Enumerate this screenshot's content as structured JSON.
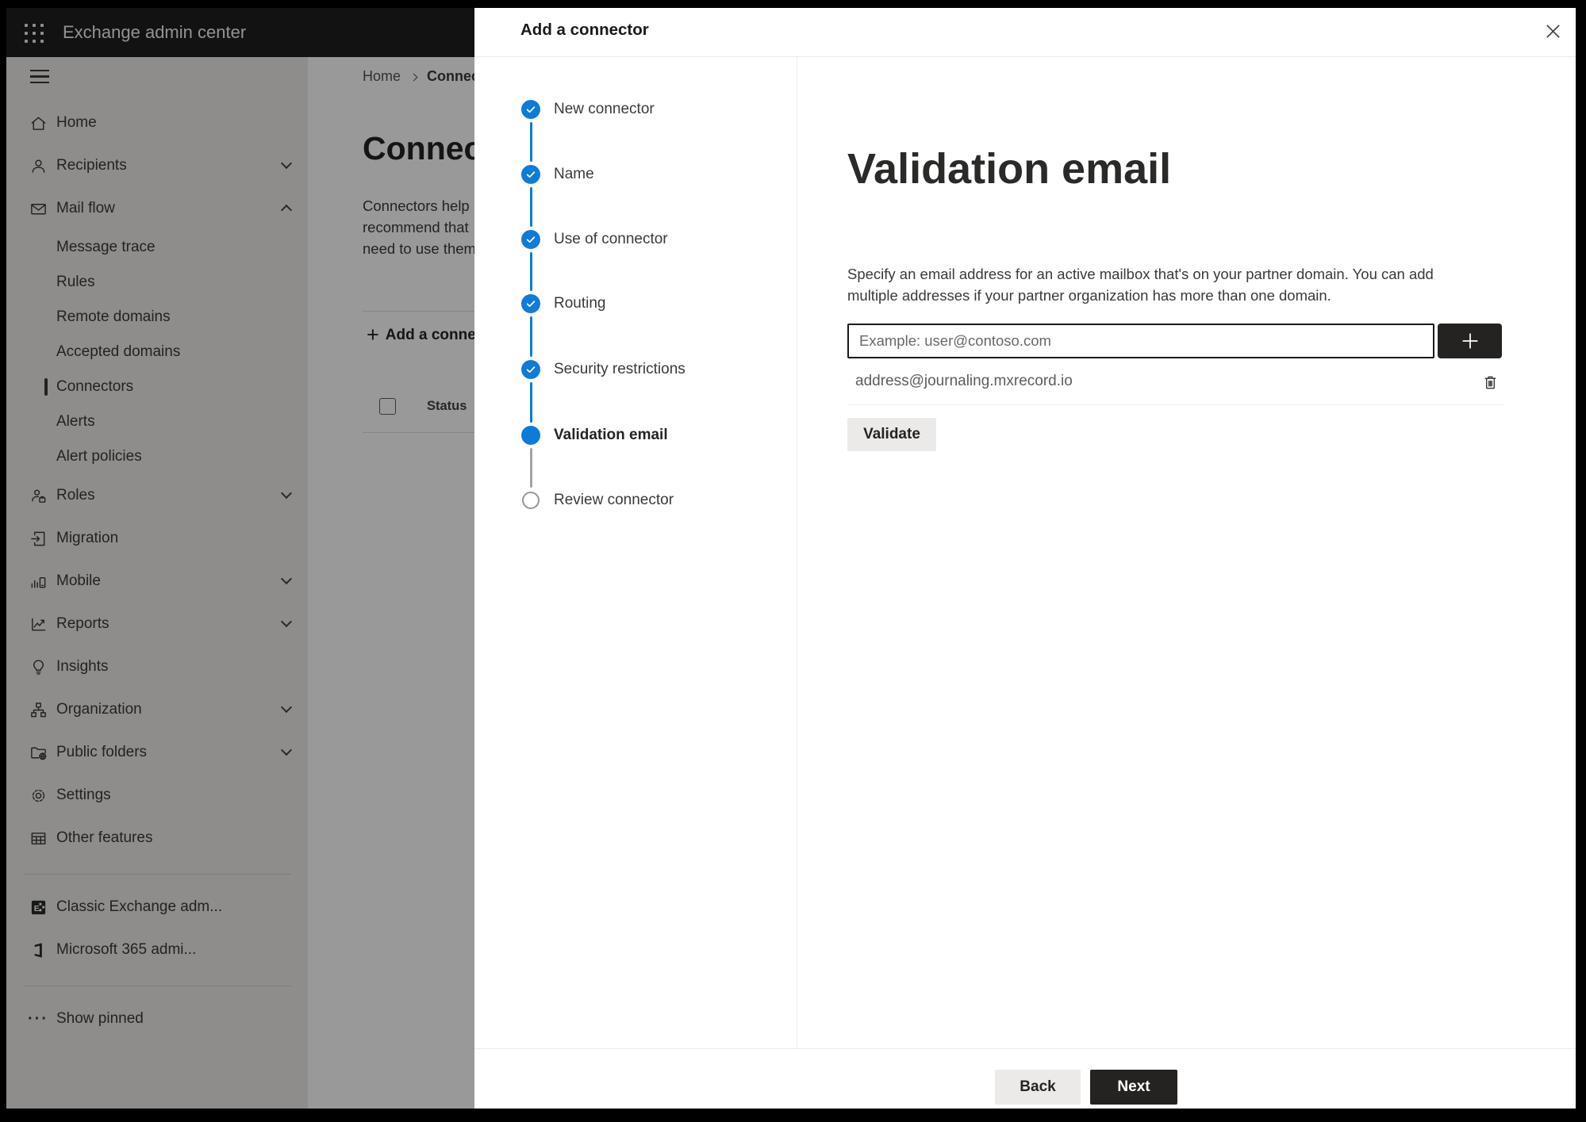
{
  "topbar": {
    "title": "Exchange admin center"
  },
  "sidebar": {
    "items": [
      {
        "type": "main",
        "label": "Home",
        "icon": "home-icon"
      },
      {
        "type": "main",
        "label": "Recipients",
        "icon": "person-icon",
        "chevron": "down"
      },
      {
        "type": "main",
        "label": "Mail flow",
        "icon": "mail-icon",
        "chevron": "up"
      },
      {
        "type": "sub",
        "label": "Message trace"
      },
      {
        "type": "sub",
        "label": "Rules"
      },
      {
        "type": "sub",
        "label": "Remote domains"
      },
      {
        "type": "sub",
        "label": "Accepted domains"
      },
      {
        "type": "sub",
        "label": "Connectors",
        "selected": true
      },
      {
        "type": "sub",
        "label": "Alerts"
      },
      {
        "type": "sub",
        "label": "Alert policies"
      },
      {
        "type": "main",
        "label": "Roles",
        "icon": "roles-icon",
        "chevron": "down"
      },
      {
        "type": "main",
        "label": "Migration",
        "icon": "migration-icon"
      },
      {
        "type": "main",
        "label": "Mobile",
        "icon": "mobile-icon",
        "chevron": "down"
      },
      {
        "type": "main",
        "label": "Reports",
        "icon": "reports-icon",
        "chevron": "down"
      },
      {
        "type": "main",
        "label": "Insights",
        "icon": "insights-icon"
      },
      {
        "type": "main",
        "label": "Organization",
        "icon": "organization-icon",
        "chevron": "down"
      },
      {
        "type": "main",
        "label": "Public folders",
        "icon": "public-folders-icon",
        "chevron": "down"
      },
      {
        "type": "main",
        "label": "Settings",
        "icon": "settings-icon"
      },
      {
        "type": "main",
        "label": "Other features",
        "icon": "other-features-icon"
      },
      {
        "type": "divider"
      },
      {
        "type": "main",
        "label": "Classic Exchange adm...",
        "icon": "classic-exchange-icon"
      },
      {
        "type": "main",
        "label": "Microsoft 365 admi...",
        "icon": "microsoft-365-icon"
      },
      {
        "type": "divider"
      },
      {
        "type": "main",
        "label": "Show pinned",
        "icon": "ellipsis-icon"
      }
    ]
  },
  "page": {
    "breadcrumb": {
      "home": "Home",
      "current": "Connectors"
    },
    "title": "Connectors",
    "description_lines": [
      "Connectors help",
      "recommend that",
      "need to use them"
    ],
    "toolbar": {
      "add_label": "Add a connector"
    },
    "table": {
      "status_column": "Status"
    }
  },
  "modal": {
    "title": "Add a connector",
    "steps": [
      {
        "label": "New connector",
        "state": "completed"
      },
      {
        "label": "Name",
        "state": "completed"
      },
      {
        "label": "Use of connector",
        "state": "completed"
      },
      {
        "label": "Routing",
        "state": "completed"
      },
      {
        "label": "Security restrictions",
        "state": "completed"
      },
      {
        "label": "Validation email",
        "state": "current"
      },
      {
        "label": "Review connector",
        "state": "upcoming"
      }
    ],
    "content": {
      "heading": "Validation email",
      "description_lines": [
        "Specify an email address for an active mailbox that's on your partner domain. You can add",
        "multiple addresses if your partner organization has more than one domain."
      ],
      "email_input_placeholder": "Example: user@contoso.com",
      "emails": [
        "address@journaling.mxrecord.io"
      ],
      "validate_label": "Validate"
    },
    "footer": {
      "back_label": "Back",
      "next_label": "Next"
    }
  },
  "colors": {
    "accent": "#0f7bd8",
    "dark_button": "#242322",
    "overlay": "rgba(0,0,0,0.40)",
    "sidebar_bg": "#edebe9",
    "topbar_bg": "#1f1f1f"
  }
}
